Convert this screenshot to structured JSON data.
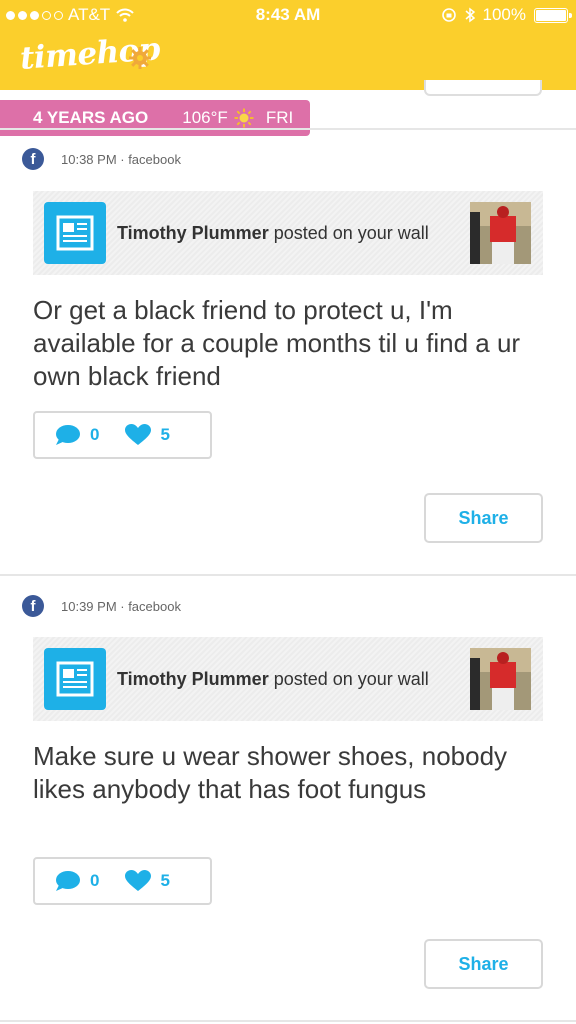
{
  "status_bar": {
    "carrier": "AT&T",
    "time": "8:43 AM",
    "battery": "100%",
    "battery_level": 1.0
  },
  "header": {
    "app_name": "timehop",
    "accent_color": "#fbcf2c"
  },
  "date_ribbon": {
    "years_ago": "4 YEARS AGO",
    "temperature": "106°F",
    "weather_icon": "sun-icon",
    "day": "FRI",
    "color": "#dd70a8"
  },
  "posts": [
    {
      "time": "10:38 PM · facebook",
      "wall_author": "Timothy Plummer",
      "wall_action": " posted on your wall",
      "text": "Or get a black friend to protect u, I'm available for a couple months til u find a ur own black friend",
      "comments": "0",
      "likes": "5",
      "share_label": "Share"
    },
    {
      "time": "10:39 PM · facebook",
      "wall_author": "Timothy Plummer",
      "wall_action": " posted on your wall",
      "text": "Make sure u wear shower shoes, nobody likes anybody that has foot fungus",
      "comments": "0",
      "likes": "5",
      "share_label": "Share"
    }
  ]
}
